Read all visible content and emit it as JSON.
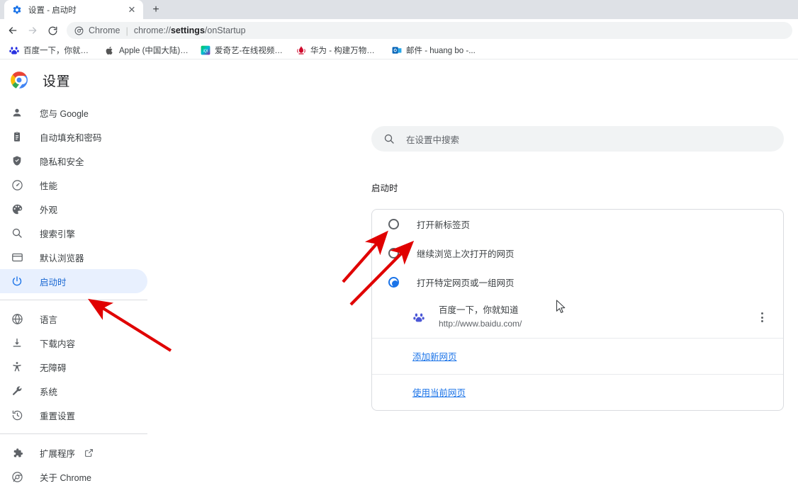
{
  "browser": {
    "tab": {
      "title": "设置 - 启动时",
      "favicon": "gear-icon",
      "close_label": "✕"
    },
    "newtab_label": "+",
    "nav": {
      "back_label": "←",
      "forward_label": "→",
      "reload_label": "⟳"
    },
    "omnibox": {
      "chip": "Chrome",
      "separator": "|",
      "url_prefix": "chrome://",
      "url_bold": "settings",
      "url_suffix": "/onStartup"
    },
    "bookmarks": [
      {
        "label": "百度一下，你就知道",
        "icon": "baidu-favicon"
      },
      {
        "label": "Apple (中国大陆) -...",
        "icon": "apple-favicon"
      },
      {
        "label": "爱奇艺-在线视频网...",
        "icon": "iqiyi-favicon"
      },
      {
        "label": "华为 - 构建万物互...",
        "icon": "huawei-favicon"
      },
      {
        "label": "邮件 - huang bo -...",
        "icon": "outlook-favicon"
      }
    ]
  },
  "settings": {
    "title": "设置",
    "logo": "chrome-logo",
    "search": {
      "placeholder": "在设置中搜索",
      "icon": "search-icon"
    },
    "sidebar": {
      "items": [
        {
          "label": "您与 Google",
          "icon": "person-icon",
          "active": false
        },
        {
          "label": "自动填充和密码",
          "icon": "clipboard-icon",
          "active": false
        },
        {
          "label": "隐私和安全",
          "icon": "shield-icon",
          "active": false
        },
        {
          "label": "性能",
          "icon": "speedometer-icon",
          "active": false
        },
        {
          "label": "外观",
          "icon": "palette-icon",
          "active": false
        },
        {
          "label": "搜索引擎",
          "icon": "search-icon",
          "active": false
        },
        {
          "label": "默认浏览器",
          "icon": "browser-window-icon",
          "active": false
        },
        {
          "label": "启动时",
          "icon": "power-icon",
          "active": true
        }
      ],
      "items2": [
        {
          "label": "语言",
          "icon": "globe-icon"
        },
        {
          "label": "下载内容",
          "icon": "download-icon"
        },
        {
          "label": "无障碍",
          "icon": "accessibility-icon"
        },
        {
          "label": "系统",
          "icon": "wrench-icon"
        },
        {
          "label": "重置设置",
          "icon": "history-restore-icon"
        }
      ],
      "items3": [
        {
          "label": "扩展程序",
          "icon": "puzzle-icon",
          "external": true
        },
        {
          "label": "关于 Chrome",
          "icon": "chrome-outline-icon",
          "external": false
        }
      ]
    },
    "main": {
      "section_title": "启动时",
      "options": [
        {
          "label": "打开新标签页",
          "checked": false
        },
        {
          "label": "继续浏览上次打开的网页",
          "checked": false
        },
        {
          "label": "打开特定网页或一组网页",
          "checked": true
        }
      ],
      "sites": [
        {
          "name": "百度一下，你就知道",
          "url": "http://www.baidu.com/",
          "favicon": "baidu-favicon",
          "menu": "more-options-icon"
        }
      ],
      "add_page_link": "添加新网页",
      "use_current_link": "使用当前网页"
    }
  },
  "annotations": {
    "color": "#e00000",
    "arrows": [
      {
        "name": "arrow-to-startup-nav",
        "desc": "points to 启动时 sidebar item"
      },
      {
        "name": "arrow-to-specific-pages-radio",
        "desc": "points to 打开特定网页或一组网页 radio"
      },
      {
        "name": "arrow-to-site-entry",
        "desc": "points to baidu site entry"
      }
    ]
  },
  "colors": {
    "accent": "#1a73e8",
    "active_nav_bg": "#e8f0fe",
    "text_primary": "#202124",
    "text_secondary": "#5f6368",
    "border": "#dadce0",
    "chrome_bg": "#dee1e6"
  }
}
